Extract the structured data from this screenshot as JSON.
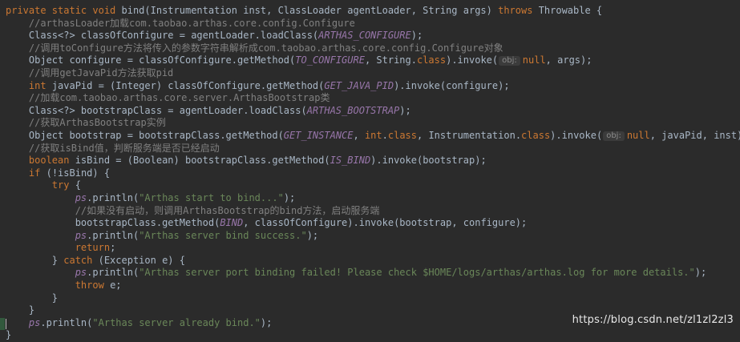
{
  "editor": {
    "watermark": "https://blog.csdn.net/zl1zl2zl3",
    "lines": [
      {
        "indent": "",
        "tokens": [
          [
            "kw",
            "private static void "
          ],
          [
            "plain",
            "bind(Instrumentation inst, ClassLoader agentLoader, String args) "
          ],
          [
            "kw",
            "throws "
          ],
          [
            "plain",
            "Throwable {"
          ]
        ]
      },
      {
        "indent": "    ",
        "tokens": [
          [
            "cmt",
            "//arthasLoader加载com.taobao.arthas.core.config.Configure"
          ]
        ]
      },
      {
        "indent": "    ",
        "tokens": [
          [
            "plain",
            "Class<?> classOfConfigure = agentLoader.loadClass("
          ],
          [
            "const",
            "ARTHAS_CONFIGURE"
          ],
          [
            "plain",
            ");"
          ]
        ]
      },
      {
        "indent": "    ",
        "tokens": [
          [
            "cmt",
            "//调用toConfigure方法将传入的参数字符串解析成com.taobao.arthas.core.config.Configure对象"
          ]
        ]
      },
      {
        "indent": "    ",
        "tokens": [
          [
            "plain",
            "Object configure = classOfConfigure.getMethod("
          ],
          [
            "const",
            "TO_CONFIGURE"
          ],
          [
            "plain",
            ", String."
          ],
          [
            "kw",
            "class"
          ],
          [
            "plain",
            ").invoke("
          ],
          [
            "hint",
            "obj:"
          ],
          [
            "kw",
            "null"
          ],
          [
            "plain",
            ", args);"
          ]
        ]
      },
      {
        "indent": "    ",
        "tokens": [
          [
            "cmt",
            "//调用getJavaPid方法获取pid"
          ]
        ]
      },
      {
        "indent": "    ",
        "tokens": [
          [
            "kw",
            "int "
          ],
          [
            "plain",
            "javaPid = (Integer) classOfConfigure.getMethod("
          ],
          [
            "const",
            "GET_JAVA_PID"
          ],
          [
            "plain",
            ").invoke(configure);"
          ]
        ]
      },
      {
        "indent": "    ",
        "tokens": [
          [
            "cmt",
            "//加载com.taobao.arthas.core.server.ArthasBootstrap类"
          ]
        ]
      },
      {
        "indent": "    ",
        "tokens": [
          [
            "plain",
            "Class<?> bootstrapClass = agentLoader.loadClass("
          ],
          [
            "const",
            "ARTHAS_BOOTSTRAP"
          ],
          [
            "plain",
            ");"
          ]
        ]
      },
      {
        "indent": "    ",
        "tokens": [
          [
            "cmt",
            "//获取ArthasBootstrap实例"
          ]
        ]
      },
      {
        "indent": "    ",
        "tokens": [
          [
            "plain",
            "Object bootstrap = bootstrapClass.getMethod("
          ],
          [
            "const",
            "GET_INSTANCE"
          ],
          [
            "plain",
            ", "
          ],
          [
            "kw",
            "int"
          ],
          [
            "plain",
            "."
          ],
          [
            "kw",
            "class"
          ],
          [
            "plain",
            ", Instrumentation."
          ],
          [
            "kw",
            "class"
          ],
          [
            "plain",
            ").invoke("
          ],
          [
            "hint",
            "obj:"
          ],
          [
            "kw",
            "null"
          ],
          [
            "plain",
            ", javaPid, inst);"
          ]
        ]
      },
      {
        "indent": "    ",
        "tokens": [
          [
            "cmt",
            "//获取isBind值，判断服务端是否已经启动"
          ]
        ]
      },
      {
        "indent": "    ",
        "tokens": [
          [
            "kw",
            "boolean "
          ],
          [
            "plain",
            "isBind = (Boolean) bootstrapClass.getMethod("
          ],
          [
            "const",
            "IS_BIND"
          ],
          [
            "plain",
            ").invoke(bootstrap);"
          ]
        ]
      },
      {
        "indent": "    ",
        "tokens": [
          [
            "kw",
            "if "
          ],
          [
            "plain",
            "(!isBind) {"
          ]
        ]
      },
      {
        "indent": "        ",
        "tokens": [
          [
            "kw",
            "try "
          ],
          [
            "plain",
            "{"
          ]
        ]
      },
      {
        "indent": "            ",
        "tokens": [
          [
            "var",
            "ps"
          ],
          [
            "plain",
            ".println("
          ],
          [
            "str",
            "\"Arthas start to bind...\""
          ],
          [
            "plain",
            ");"
          ]
        ]
      },
      {
        "indent": "            ",
        "tokens": [
          [
            "cmt",
            "//如果没有启动，则调用ArthasBootstrap的bind方法，启动服务端"
          ]
        ]
      },
      {
        "indent": "            ",
        "tokens": [
          [
            "plain",
            "bootstrapClass.getMethod("
          ],
          [
            "const",
            "BIND"
          ],
          [
            "plain",
            ", classOfConfigure).invoke(bootstrap, configure);"
          ]
        ]
      },
      {
        "indent": "            ",
        "tokens": [
          [
            "var",
            "ps"
          ],
          [
            "plain",
            ".println("
          ],
          [
            "str",
            "\"Arthas server bind success.\""
          ],
          [
            "plain",
            ");"
          ]
        ]
      },
      {
        "indent": "            ",
        "tokens": [
          [
            "kw",
            "return"
          ],
          [
            "plain",
            ";"
          ]
        ]
      },
      {
        "indent": "        ",
        "tokens": [
          [
            "plain",
            "} "
          ],
          [
            "kw",
            "catch "
          ],
          [
            "plain",
            "(Exception e) {"
          ]
        ]
      },
      {
        "indent": "            ",
        "tokens": [
          [
            "var",
            "ps"
          ],
          [
            "plain",
            ".println("
          ],
          [
            "str",
            "\"Arthas server port binding failed! Please check $HOME/logs/arthas/arthas.log for more details.\""
          ],
          [
            "plain",
            ");"
          ]
        ]
      },
      {
        "indent": "            ",
        "tokens": [
          [
            "kw",
            "throw "
          ],
          [
            "plain",
            "e;"
          ]
        ]
      },
      {
        "indent": "        ",
        "tokens": [
          [
            "plain",
            "}"
          ]
        ]
      },
      {
        "indent": "    ",
        "tokens": [
          [
            "plain",
            "}"
          ]
        ]
      },
      {
        "indent": "    ",
        "tokens": [
          [
            "var",
            "ps"
          ],
          [
            "plain",
            ".println("
          ],
          [
            "str",
            "\"Arthas server already bind.\""
          ],
          [
            "plain",
            ");"
          ]
        ]
      },
      {
        "indent": "",
        "tokens": [
          [
            "plain",
            "}"
          ]
        ]
      }
    ]
  }
}
